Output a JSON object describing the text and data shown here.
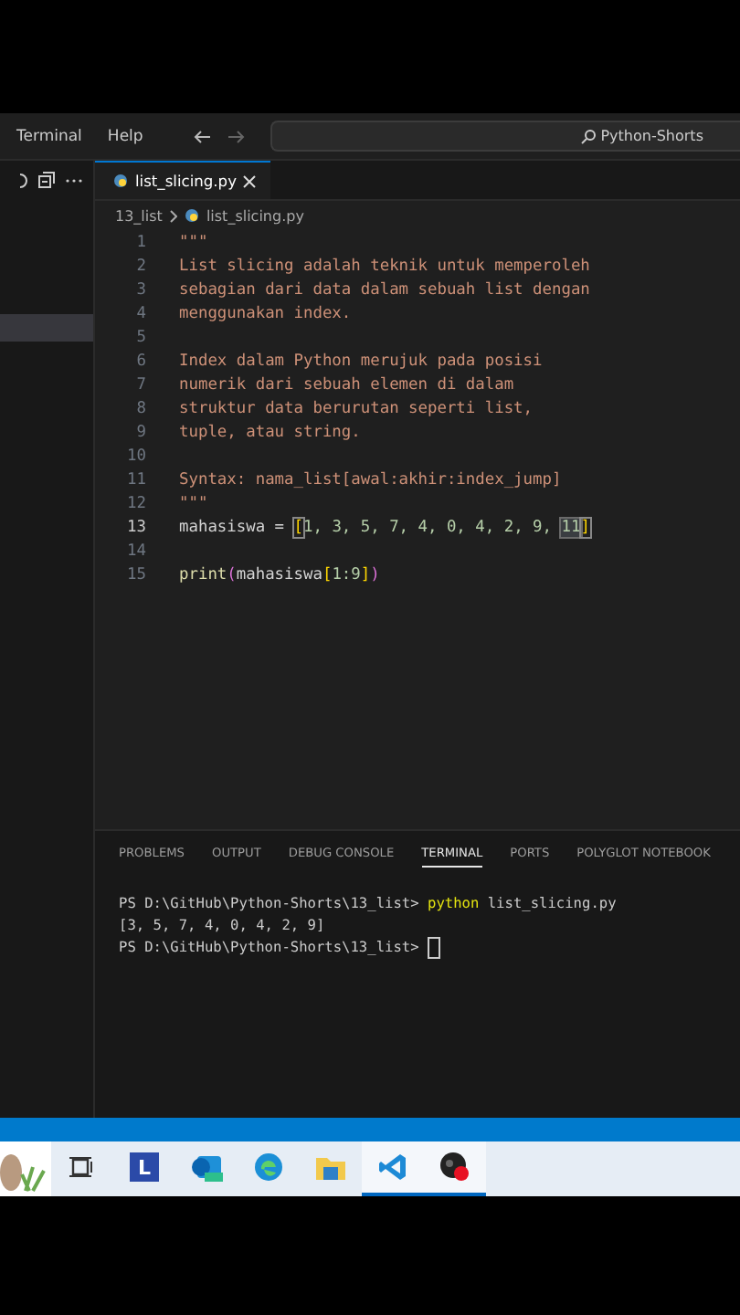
{
  "title_bar": {
    "menu": [
      "Terminal",
      "Help"
    ],
    "search": {
      "value": "Python-Shorts"
    }
  },
  "sidebar": {
    "rows": [
      {
        "selected": true
      }
    ]
  },
  "editor": {
    "tabs": [
      {
        "label": "list_slicing.py",
        "selected": true
      }
    ],
    "breadcrumbs": [
      "13_list",
      "list_slicing.py"
    ],
    "lines": [
      {
        "number": "1",
        "current": false,
        "tokens": [
          {
            "text": "\"\"\"",
            "kind": "string"
          }
        ]
      },
      {
        "number": "2",
        "current": false,
        "tokens": [
          {
            "text": "List slicing adalah teknik untuk memperoleh",
            "kind": "string"
          }
        ]
      },
      {
        "number": "3",
        "current": false,
        "tokens": [
          {
            "text": "sebagian dari data dalam sebuah list dengan",
            "kind": "string"
          }
        ]
      },
      {
        "number": "4",
        "current": false,
        "tokens": [
          {
            "text": "menggunakan index.",
            "kind": "string"
          }
        ]
      },
      {
        "number": "5",
        "current": false
      },
      {
        "number": "6",
        "current": false,
        "tokens": [
          {
            "text": "Index dalam Python merujuk pada posisi",
            "kind": "string"
          }
        ]
      },
      {
        "number": "7",
        "current": false,
        "tokens": [
          {
            "text": "numerik dari sebuah elemen di dalam",
            "kind": "string"
          }
        ]
      },
      {
        "number": "8",
        "current": false,
        "tokens": [
          {
            "text": "struktur data berurutan seperti list,",
            "kind": "string"
          }
        ]
      },
      {
        "number": "9",
        "current": false,
        "tokens": [
          {
            "text": "tuple, atau string.",
            "kind": "string"
          }
        ]
      },
      {
        "number": "10",
        "current": false
      },
      {
        "number": "11",
        "current": false,
        "tokens": [
          {
            "text": "Syntax: nama_list[awal:akhir:index_jump]",
            "kind": "string"
          }
        ]
      },
      {
        "number": "12",
        "current": false,
        "tokens": [
          {
            "text": "\"\"\"",
            "kind": "string"
          }
        ]
      },
      {
        "number": "13",
        "current": true,
        "tokens": [
          {
            "text": "mahasiswa = ",
            "kind": "plain"
          },
          {
            "text": "[",
            "kind": "bracket-match"
          },
          {
            "text": "1, 3, 5, 7, 4, 0, 4, 2, 9, ",
            "kind": "number"
          },
          {
            "text": "11",
            "kind": "selection"
          },
          {
            "text": "]",
            "kind": "bracket-match"
          }
        ]
      },
      {
        "number": "14",
        "current": false
      },
      {
        "number": "15",
        "current": false,
        "tokens": [
          {
            "text": "print",
            "kind": "function"
          },
          {
            "text": "(",
            "kind": "paren"
          },
          {
            "text": "mahasiswa",
            "kind": "plain"
          },
          {
            "text": "[",
            "kind": "bracket"
          },
          {
            "text": "1:9",
            "kind": "number"
          },
          {
            "text": "]",
            "kind": "bracket"
          },
          {
            "text": ")",
            "kind": "paren"
          }
        ]
      }
    ]
  },
  "panel": {
    "tabs": [
      {
        "label": "PROBLEMS",
        "selected": false
      },
      {
        "label": "OUTPUT",
        "selected": false
      },
      {
        "label": "DEBUG CONSOLE",
        "selected": false
      },
      {
        "label": "TERMINAL",
        "selected": true
      },
      {
        "label": "PORTS",
        "selected": false
      },
      {
        "label": "POLYGLOT NOTEBOOK",
        "selected": false
      }
    ],
    "terminal": [
      {
        "cursor": false,
        "tokens": [
          {
            "text": "PS D:\\GitHub\\Python-Shorts\\13_list> ",
            "kind": "plain"
          },
          {
            "text": "python",
            "kind": "command"
          },
          {
            "text": " list_slicing.py",
            "kind": "plain"
          }
        ]
      },
      {
        "cursor": false,
        "tokens": [
          {
            "text": "[3, 5, 7, 4, 0, 4, 2, 9]",
            "kind": "plain"
          }
        ]
      },
      {
        "cursor": true,
        "tokens": [
          {
            "text": "PS D:\\GitHub\\Python-Shorts\\13_list> ",
            "kind": "plain"
          }
        ]
      }
    ]
  },
  "taskbar": {
    "apps": [
      {
        "kind": "widget",
        "active": false
      },
      {
        "kind": "task-view",
        "active": false
      },
      {
        "kind": "letter-app",
        "letter": "L",
        "active": false
      },
      {
        "kind": "mail",
        "active": false
      },
      {
        "kind": "browser",
        "active": false
      },
      {
        "kind": "folder",
        "active": false
      },
      {
        "kind": "code-editor",
        "active": true
      },
      {
        "kind": "recorder",
        "active": true
      }
    ]
  }
}
